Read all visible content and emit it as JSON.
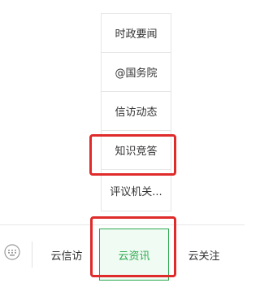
{
  "submenu": {
    "items": [
      {
        "label": "时政要闻"
      },
      {
        "label": "@国务院"
      },
      {
        "label": "信访动态"
      },
      {
        "label": "知识竞答"
      },
      {
        "label": "评议机关..."
      }
    ]
  },
  "bottom_nav": {
    "keyboard_icon": "keyboard-icon",
    "items": [
      {
        "label": "云信访"
      },
      {
        "label": "云资讯"
      },
      {
        "label": "云关注"
      }
    ],
    "active_color": "#2ea850"
  },
  "annotations": {
    "highlight_color": "#e02b2b"
  }
}
